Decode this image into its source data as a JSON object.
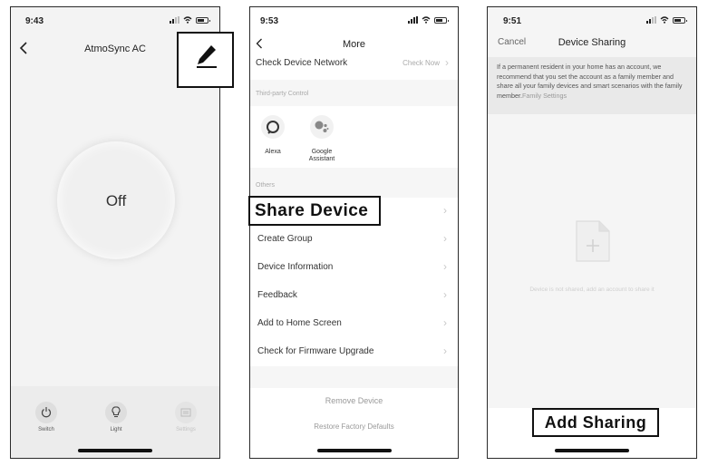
{
  "phone1": {
    "status_time": "9:43",
    "title": "AtmoSync AC",
    "power_state": "Off",
    "bottom_actions": [
      {
        "label": "Switch",
        "icon": "power-icon"
      },
      {
        "label": "Light",
        "icon": "bulb-icon"
      },
      {
        "label": "Settings",
        "icon": "settings-icon"
      }
    ]
  },
  "phone2": {
    "status_time": "9:53",
    "title": "More",
    "check_network": {
      "label": "Check Device Network",
      "value": "Check Now"
    },
    "third_party_header": "Third-party Control",
    "third_party": [
      {
        "label": "Alexa",
        "icon": "alexa-icon"
      },
      {
        "label": "Google\nAssistant",
        "icon": "google-assistant-icon"
      }
    ],
    "others_header": "Others",
    "share_device": "Share Device",
    "menu_items": [
      "Create Group",
      "Device Information",
      "Feedback",
      "Add to Home Screen",
      "Check for Firmware Upgrade"
    ],
    "remove_device": "Remove Device",
    "restore_defaults": "Restore Factory Defaults"
  },
  "phone3": {
    "status_time": "9:51",
    "cancel": "Cancel",
    "title": "Device Sharing",
    "notice": "If a permanent resident in your home has an account, we recommend that you set the account as a family member and share all your family devices and smart scenarios with the family member.",
    "notice_link": "Family Settings",
    "empty_text": "Device is not shared, add an account to share it",
    "add_sharing": "Add Sharing"
  },
  "colors": {
    "background": "#f6f6f6",
    "secondary_text": "#9a9a9a",
    "notice_bg": "#e9e9e9"
  }
}
